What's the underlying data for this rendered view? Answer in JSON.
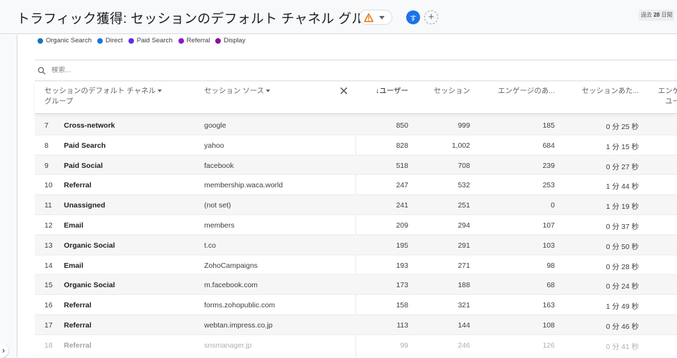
{
  "header": {
    "title": "トラフィック獲得: セッションのデフォルト チャネル グループ",
    "warning_icon": "warning-triangle-icon",
    "avatar_letter": "す",
    "add_label": "+",
    "date_prefix": "過去",
    "date_days": "28",
    "date_suffix": "日間"
  },
  "legend": [
    {
      "label": "Organic Search",
      "color": "#1a73b8"
    },
    {
      "label": "Direct",
      "color": "#1a73e8"
    },
    {
      "label": "Paid Search",
      "color": "#5b2ee8"
    },
    {
      "label": "Referral",
      "color": "#8a19d4"
    },
    {
      "label": "Display",
      "color": "#8e0e9e"
    }
  ],
  "search": {
    "placeholder": "検索..."
  },
  "table": {
    "columns": {
      "channel_line1": "セッションのデフォルト チャネル",
      "channel_line2": "グループ",
      "source": "セッション ソース",
      "users": "↓ユーザー",
      "sessions": "セッション",
      "engaged": "エンゲージのあ...",
      "per_session": "セッションあた...",
      "engaged_users_line1": "エンゲ",
      "engaged_users_line2": "ユー"
    },
    "rows": [
      {
        "idx": "7",
        "channel": "Cross-network",
        "source": "google",
        "users": "850",
        "sessions": "999",
        "engaged": "185",
        "duration": "0 分 25 秒"
      },
      {
        "idx": "8",
        "channel": "Paid Search",
        "source": "yahoo",
        "users": "828",
        "sessions": "1,002",
        "engaged": "684",
        "duration": "1 分 15 秒"
      },
      {
        "idx": "9",
        "channel": "Paid Social",
        "source": "facebook",
        "users": "518",
        "sessions": "708",
        "engaged": "239",
        "duration": "0 分 27 秒"
      },
      {
        "idx": "10",
        "channel": "Referral",
        "source": "membership.waca.world",
        "users": "247",
        "sessions": "532",
        "engaged": "253",
        "duration": "1 分 44 秒"
      },
      {
        "idx": "11",
        "channel": "Unassigned",
        "source": "(not set)",
        "users": "241",
        "sessions": "251",
        "engaged": "0",
        "duration": "1 分 19 秒"
      },
      {
        "idx": "12",
        "channel": "Email",
        "source": "members",
        "users": "209",
        "sessions": "294",
        "engaged": "107",
        "duration": "0 分 37 秒"
      },
      {
        "idx": "13",
        "channel": "Organic Social",
        "source": "t.co",
        "users": "195",
        "sessions": "291",
        "engaged": "103",
        "duration": "0 分 50 秒"
      },
      {
        "idx": "14",
        "channel": "Email",
        "source": "ZohoCampaigns",
        "users": "193",
        "sessions": "271",
        "engaged": "98",
        "duration": "0 分 28 秒"
      },
      {
        "idx": "15",
        "channel": "Organic Social",
        "source": "m.facebook.com",
        "users": "173",
        "sessions": "188",
        "engaged": "68",
        "duration": "0 分 24 秒"
      },
      {
        "idx": "16",
        "channel": "Referral",
        "source": "forms.zohopublic.com",
        "users": "158",
        "sessions": "321",
        "engaged": "163",
        "duration": "1 分 49 秒"
      },
      {
        "idx": "17",
        "channel": "Referral",
        "source": "webtan.impress.co.jp",
        "users": "113",
        "sessions": "144",
        "engaged": "108",
        "duration": "0 分 46 秒"
      },
      {
        "idx": "18",
        "channel": "Referral",
        "source": "snsmanager.jp",
        "users": "99",
        "sessions": "246",
        "engaged": "126",
        "duration": "0 分 41 秒"
      }
    ]
  }
}
